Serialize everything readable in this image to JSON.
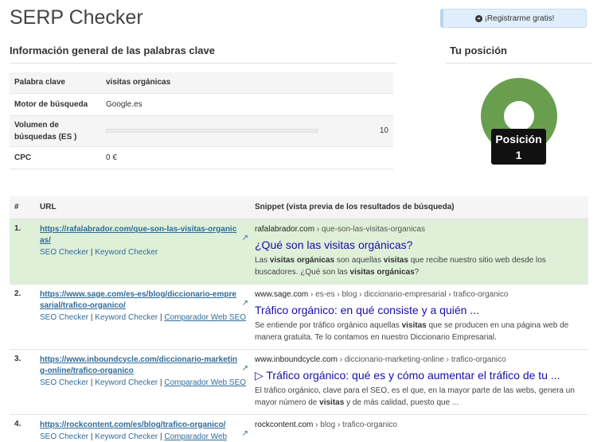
{
  "app_title": "SERP Checker",
  "register_button": "¡Registrarme gratis!",
  "overview": {
    "title": "Información general de las palabras clave",
    "rows": [
      {
        "label": "Palabra clave",
        "value": "visitas orgánicas"
      },
      {
        "label": "Motor de búsqueda",
        "value": "Google.es"
      },
      {
        "label": "Volumen de búsquedas (ES )",
        "value": "10"
      },
      {
        "label": "CPC",
        "value": "0 €"
      }
    ]
  },
  "position": {
    "title": "Tu posición",
    "badge_word": "Posición",
    "badge_number": "1",
    "ring_color": "#6a9e4f"
  },
  "results_table": {
    "headers": {
      "num": "#",
      "url": "URL",
      "snippet": "Snippet (vista previa de los resultados de búsqueda)"
    },
    "rows": [
      {
        "num": "1.",
        "url": "https://rafalabrador.com/que-son-las-visitas-organicas/",
        "tools": [
          "SEO Checker",
          "Keyword Checker"
        ],
        "domain": "rafalabrador.com",
        "breadcrumb": " › que-son-las-visitas-organicas",
        "title": "¿Qué son las visitas orgánicas?",
        "desc_parts": [
          "Las ",
          "visitas orgánicas",
          " son aquellas ",
          "visitas",
          " que recibe nuestro sitio web desde los buscadores. ¿Qué son las ",
          "visitas orgánicas",
          "?"
        ]
      },
      {
        "num": "2.",
        "url": "https://www.sage.com/es-es/blog/diccionario-empresarial/trafico-organico/",
        "tools": [
          "SEO Checker",
          "Keyword Checker",
          "Comparador Web SEO"
        ],
        "domain": "www.sage.com",
        "breadcrumb": " › es-es › blog › diccionario-empresarial › trafico-organico",
        "title": "Tráfico orgánico: en qué consiste y a quién ...",
        "desc_parts": [
          "Se entiende por tráfico orgánico aquellas ",
          "visitas",
          " que se producen en una página web de manera gratuita. Te lo contamos en nuestro Diccionario Empresarial."
        ]
      },
      {
        "num": "3.",
        "url": "https://www.inboundcycle.com/diccionario-marketing-online/trafico-organico",
        "tools": [
          "SEO Checker",
          "Keyword Checker",
          "Comparador Web SEO"
        ],
        "domain": "www.inboundcycle.com",
        "breadcrumb": " › diccionario-marketing-online › trafico-organico",
        "title": "▷ Tráfico orgánico: qué es y cómo aumentar el tráfico de tu ...",
        "desc_parts": [
          "El tráfico orgánico, clave para el SEO, es el que, en la mayor parte de las webs, genera un mayor número de ",
          "visitas",
          " y de más calidad, puesto que ..."
        ]
      },
      {
        "num": "4.",
        "url": "https://rockcontent.com/es/blog/trafico-organico/",
        "tools": [
          "SEO Checker",
          "Keyword Checker",
          "Comparador Web SEO"
        ],
        "domain": "rockcontent.com",
        "breadcrumb": " › blog › trafico-organico",
        "title": "",
        "desc_parts": []
      }
    ]
  }
}
